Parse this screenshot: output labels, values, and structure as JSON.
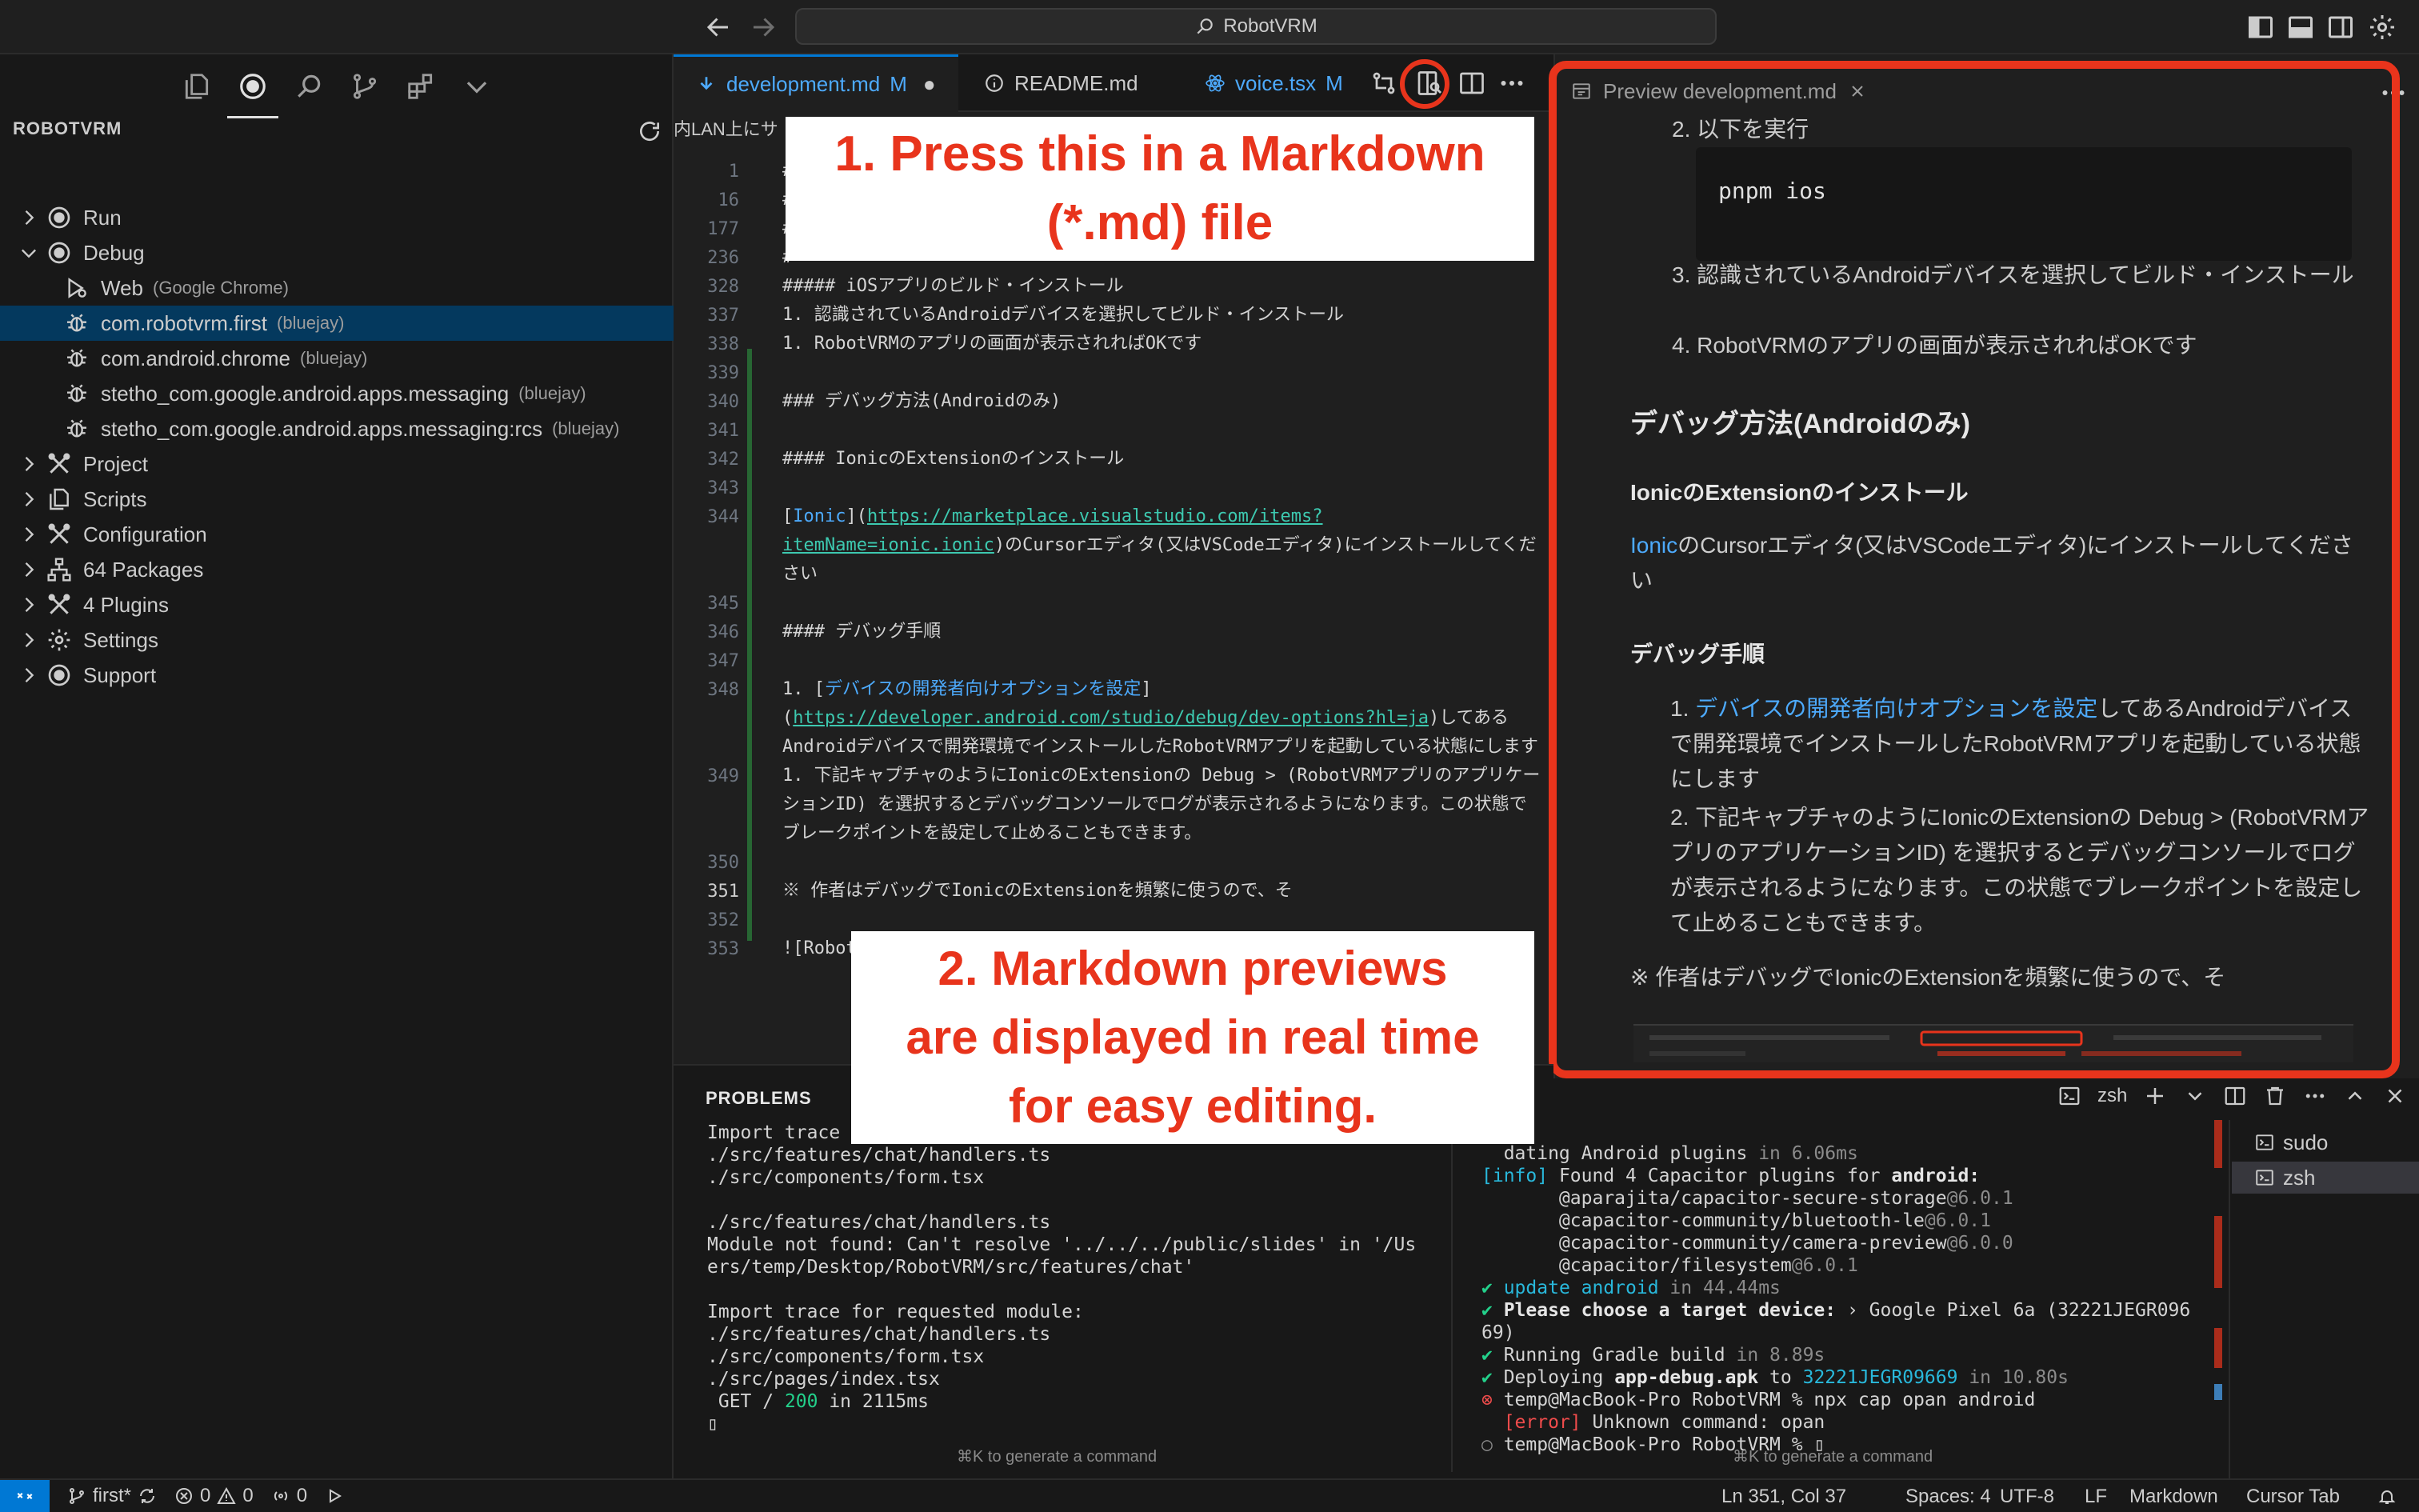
{
  "titlebar": {
    "command_center_text": "RobotVRM",
    "icons": [
      "arrow-left-icon",
      "arrow-right-icon",
      "search-icon",
      "layout-sidebar-left-icon",
      "layout-panel-icon",
      "layout-sidebar-right-icon",
      "settings-gear-icon"
    ]
  },
  "sidebar": {
    "activity_icons": [
      "files-icon",
      "run-debug-icon",
      "search-icon",
      "source-control-icon",
      "extensions-icon",
      "chevron-down-icon"
    ],
    "title": "ROBOTVRM",
    "items": [
      {
        "label": "Run",
        "desc": "",
        "icon": "run-circle-icon",
        "chevron": "right",
        "indent": 0
      },
      {
        "label": "Debug",
        "desc": "",
        "icon": "debug-circle-icon",
        "chevron": "down",
        "indent": 0
      },
      {
        "label": "Web",
        "desc": "(Google Chrome)",
        "icon": "debug-alt-icon",
        "chevron": "",
        "indent": 1
      },
      {
        "label": "com.robotvrm.first",
        "desc": "(bluejay)",
        "icon": "bug-icon",
        "chevron": "",
        "indent": 1,
        "selected": true
      },
      {
        "label": "com.android.chrome",
        "desc": "(bluejay)",
        "icon": "bug-icon",
        "chevron": "",
        "indent": 1
      },
      {
        "label": "stetho_com.google.android.apps.messaging",
        "desc": "(bluejay)",
        "icon": "bug-icon",
        "chevron": "",
        "indent": 1
      },
      {
        "label": "stetho_com.google.android.apps.messaging:rcs",
        "desc": "(bluejay)",
        "icon": "bug-icon",
        "chevron": "",
        "indent": 1
      },
      {
        "label": "Project",
        "desc": "",
        "icon": "tools-icon",
        "chevron": "right",
        "indent": 0
      },
      {
        "label": "Scripts",
        "desc": "",
        "icon": "files-icon",
        "chevron": "right",
        "indent": 0
      },
      {
        "label": "Configuration",
        "desc": "",
        "icon": "tools-icon",
        "chevron": "right",
        "indent": 0
      },
      {
        "label": "64 Packages",
        "desc": "",
        "icon": "type-hierarchy-icon",
        "chevron": "right",
        "indent": 0
      },
      {
        "label": "4 Plugins",
        "desc": "",
        "icon": "tools-icon",
        "chevron": "right",
        "indent": 0
      },
      {
        "label": "Settings",
        "desc": "",
        "icon": "gear-icon",
        "chevron": "right",
        "indent": 0
      },
      {
        "label": "Support",
        "desc": "",
        "icon": "support-circle-icon",
        "chevron": "right",
        "indent": 0
      }
    ]
  },
  "tabs": [
    {
      "label": "development.md",
      "badge": "M",
      "modified": "●",
      "active": true,
      "icon": "markdown-icon"
    },
    {
      "label": "README.md",
      "badge": "",
      "modified": "",
      "active": false,
      "icon": "info-icon"
    },
    {
      "label": "voice.tsx",
      "badge": "M",
      "modified": "",
      "active": false,
      "icon": "react-icon"
    }
  ],
  "editor": {
    "breadcrumb_fragment": "内LAN上にサ",
    "lines": [
      {
        "n": "1",
        "text": "#"
      },
      {
        "n": "16",
        "text": "#"
      },
      {
        "n": "177",
        "text": "#"
      },
      {
        "n": "236",
        "text": "#"
      },
      {
        "n": "328",
        "text": "##### iOSアプリのビルド・インストール"
      },
      {
        "n": "337",
        "text": "1. 認識されているAndroidデバイスを選択してビルド・インストール"
      },
      {
        "n": "338",
        "text": "1. RobotVRMのアプリの画面が表示されればOKです"
      },
      {
        "n": "339",
        "text": ""
      },
      {
        "n": "340",
        "text": "### デバッグ方法(Androidのみ)"
      },
      {
        "n": "341",
        "text": ""
      },
      {
        "n": "342",
        "text": "#### IonicのExtensionのインストール"
      },
      {
        "n": "343",
        "text": ""
      },
      {
        "n": "344",
        "pre": "[",
        "link_text": "Ionic",
        "mid": "](",
        "url": "https://marketplace.visualstudio.com/items?itemName=ionic.ionic",
        "post": ")のCursorエディタ(又はVSCodeエディタ)にインストールしてください"
      },
      {
        "n": "345",
        "text": ""
      },
      {
        "n": "346",
        "text": "#### デバッグ手順"
      },
      {
        "n": "347",
        "text": ""
      },
      {
        "n": "348",
        "pre": "1. [",
        "link_text": "デバイスの開発者向けオプションを設定",
        "mid": "](",
        "url": "https://developer.android.com/studio/debug/dev-options?hl=ja",
        "post": ")してあるAndroidデバイスで開発環境でインストールしたRobotVRMアプリを起動している状態にします"
      },
      {
        "n": "349",
        "text": "1. 下記キャプチャのようにIonicのExtensionの Debug > (RobotVRMアプリのアプリケーションID) を選択するとデバッグコンソールでログが表示されるようになります。この状態でブレークポイントを設定して止めることもできます。"
      },
      {
        "n": "350",
        "text": ""
      },
      {
        "n": "351",
        "text": "※ 作者はデバッグでIonicのExtensionを頻繁に使うので、そ"
      },
      {
        "n": "352",
        "text": ""
      },
      {
        "n": "353",
        "text": "![RobotVRMのデバッグ(機能)](./docs/img..."
      }
    ],
    "current_line": "351"
  },
  "annotations": {
    "callout1": [
      "1. Press this in a Markdown",
      "(*.md) file"
    ],
    "callout2": [
      "2. Markdown previews",
      "are displayed in real time",
      "for easy editing."
    ]
  },
  "preview": {
    "tab_label": "Preview development.md",
    "item2_label": "以下を実行",
    "code": "pnpm ios",
    "item3": "認識されているAndroidデバイスを選択してビルド・インストール",
    "item4": "RobotVRMのアプリの画面が表示されればOKです",
    "h_debug": "デバッグ方法(Androidのみ)",
    "h_ext": "IonicのExtensionのインストール",
    "ext_link": "Ionic",
    "ext_body": "のCursorエディタ(又はVSCodeエディタ)にインストールしてください",
    "h_steps": "デバッグ手順",
    "step1_link": "デバイスの開発者向けオプションを設定",
    "step1_body": "してあるAndroidデバイスで開発環境でインストールしたRobotVRMアプリを起動している状態にします",
    "step2": "下記キャプチャのようにIonicのExtensionの Debug > (RobotVRMアプリのアプリケーションID) を選択するとデバッグコンソールでログが表示されるようになります。この状態でブレークポイントを設定して止めることもできます。",
    "note": "※ 作者はデバッグでIonicのExtensionを頻繁に使うので、そ"
  },
  "panel": {
    "tab_problems": "PROBLEMS",
    "left_lines": [
      {
        "t": "Import trace"
      },
      {
        "t": "./src/features/chat/handlers.ts"
      },
      {
        "t": "./src/components/form.tsx"
      },
      {
        "t": ""
      },
      {
        "t": "./src/features/chat/handlers.ts"
      },
      {
        "t": "Module not found: Can't resolve '../../../public/slides' in '/Us"
      },
      {
        "t": "ers/temp/Desktop/RobotVRM/src/features/chat'"
      },
      {
        "t": ""
      },
      {
        "t": "Import trace for requested module:"
      },
      {
        "t": "./src/features/chat/handlers.ts"
      },
      {
        "t": "./src/components/form.tsx"
      },
      {
        "t": "./src/pages/index.tsx"
      },
      {
        "t": " GET / ",
        "num": "200",
        "tail": " in 2115ms"
      },
      {
        "t": "▯"
      }
    ],
    "right_lines": [
      {
        "parts": [
          {
            "c": "",
            "t": "  dating Android plugins "
          },
          {
            "c": "t-gray",
            "t": "in 6.06ms"
          }
        ]
      },
      {
        "parts": [
          {
            "c": "t-cyan",
            "t": "[info]"
          },
          {
            "c": "",
            "t": " Found 4 Capacitor plugins for "
          },
          {
            "c": "t-bold",
            "t": "android:"
          }
        ]
      },
      {
        "parts": [
          {
            "c": "",
            "t": "       @aparajita/capacitor-secure-storage"
          },
          {
            "c": "t-gray",
            "t": "@6.0.1"
          }
        ]
      },
      {
        "parts": [
          {
            "c": "",
            "t": "       @capacitor-community/bluetooth-le"
          },
          {
            "c": "t-gray",
            "t": "@6.0.1"
          }
        ]
      },
      {
        "parts": [
          {
            "c": "",
            "t": "       @capacitor-community/camera-preview"
          },
          {
            "c": "t-gray",
            "t": "@6.0.0"
          }
        ]
      },
      {
        "parts": [
          {
            "c": "",
            "t": "       @capacitor/filesystem"
          },
          {
            "c": "t-gray",
            "t": "@6.0.1"
          }
        ]
      },
      {
        "parts": [
          {
            "c": "t-green",
            "t": "✔ "
          },
          {
            "c": "t-cyan",
            "t": "update android"
          },
          {
            "c": "t-gray",
            "t": " in 44.44ms"
          }
        ]
      },
      {
        "parts": [
          {
            "c": "t-green",
            "t": "✔ "
          },
          {
            "c": "t-bold",
            "t": "Please choose a target device:"
          },
          {
            "c": "",
            "t": " › Google Pixel 6a (32221JEGR096"
          }
        ]
      },
      {
        "parts": [
          {
            "c": "",
            "t": "69)"
          }
        ]
      },
      {
        "parts": [
          {
            "c": "t-green",
            "t": "✔ "
          },
          {
            "c": "",
            "t": "Running Gradle build"
          },
          {
            "c": "t-gray",
            "t": " in 8.89s"
          }
        ]
      },
      {
        "parts": [
          {
            "c": "t-green",
            "t": "✔ "
          },
          {
            "c": "",
            "t": "Deploying "
          },
          {
            "c": "t-bold",
            "t": "app-debug.apk"
          },
          {
            "c": "",
            "t": " to "
          },
          {
            "c": "t-cyan",
            "t": "32221JEGR09669"
          },
          {
            "c": "t-gray",
            "t": " in 10.80s"
          }
        ]
      },
      {
        "parts": [
          {
            "c": "t-red",
            "t": "⊗ "
          },
          {
            "c": "",
            "t": "temp@MacBook-Pro RobotVRM % npx cap opan android"
          }
        ]
      },
      {
        "parts": [
          {
            "c": "",
            "t": "  "
          },
          {
            "c": "t-red",
            "t": "[error]"
          },
          {
            "c": "",
            "t": " Unknown command: opan"
          }
        ]
      },
      {
        "parts": [
          {
            "c": "t-gray",
            "t": "○ "
          },
          {
            "c": "",
            "t": "temp@MacBook-Pro RobotVRM % ▯"
          }
        ]
      }
    ],
    "hint": "⌘K to generate a command",
    "shell_label": "zsh",
    "term_list": [
      {
        "label": "sudo",
        "selected": false
      },
      {
        "label": "zsh",
        "selected": true
      }
    ]
  },
  "statusbar": {
    "branch": "first*",
    "errors": "0",
    "warnings": "0",
    "ports": "0",
    "position": "Ln 351, Col 37",
    "spaces": "Spaces: 4",
    "encoding": "UTF-8",
    "eol": "LF",
    "language": "Markdown",
    "tab_mode": "Cursor Tab"
  },
  "colors": {
    "accent": "#0078d4",
    "annotation_red": "#e8341c",
    "selection": "#04395e"
  }
}
